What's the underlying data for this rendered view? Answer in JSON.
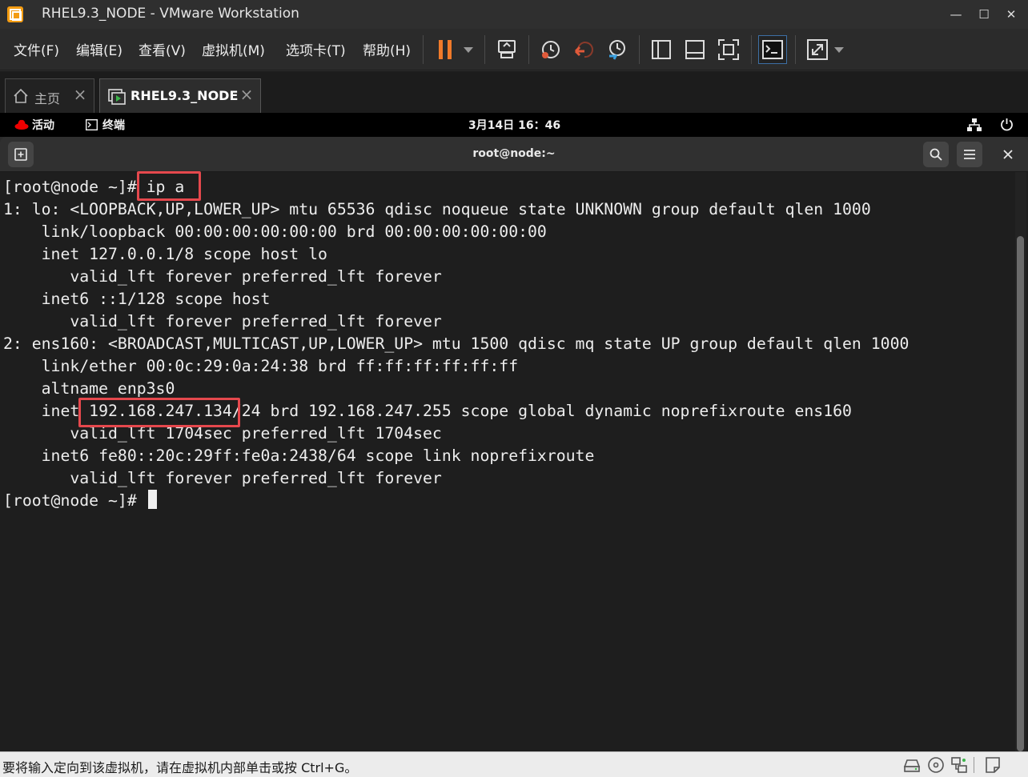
{
  "window": {
    "title": "RHEL9.3_NODE - VMware Workstation",
    "minimize": "—",
    "maximize": "☐",
    "close": "✕",
    "accent_color": "#f39c12"
  },
  "menu": {
    "items": [
      "文件(F)",
      "编辑(E)",
      "查看(V)",
      "虚拟机(M)",
      "选项卡(T)",
      "帮助(H)"
    ]
  },
  "toolbar": {
    "icons": [
      "pause-icon",
      "send-ctrl-alt-del-icon",
      "snapshot-take-icon",
      "snapshot-revert-icon",
      "snapshot-manager-icon",
      "library-view-icon",
      "thumbnail-view-icon",
      "fullscreen-icon",
      "console-view-icon",
      "stretch-view-icon"
    ]
  },
  "tabs": [
    {
      "label": "主页",
      "icon": "home-icon",
      "active": false
    },
    {
      "label": "RHEL9.3_NODE",
      "icon": "vm-icon",
      "active": true
    }
  ],
  "gnome": {
    "activities": "活动",
    "app": "终端",
    "clock": "3月14日  16：46",
    "status_icons": [
      "network-icon",
      "power-icon"
    ]
  },
  "terminal": {
    "title": "root@node:~",
    "lines": [
      "[root@node ~]# ip a",
      "1: lo: <LOOPBACK,UP,LOWER_UP> mtu 65536 qdisc noqueue state UNKNOWN group default qlen 1000",
      "    link/loopback 00:00:00:00:00:00 brd 00:00:00:00:00:00",
      "    inet 127.0.0.1/8 scope host lo",
      "       valid_lft forever preferred_lft forever",
      "    inet6 ::1/128 scope host",
      "       valid_lft forever preferred_lft forever",
      "2: ens160: <BROADCAST,MULTICAST,UP,LOWER_UP> mtu 1500 qdisc mq state UP group default qlen 1000",
      "    link/ether 00:0c:29:0a:24:38 brd ff:ff:ff:ff:ff:ff",
      "    altname enp3s0",
      "    inet 192.168.247.134/24 brd 192.168.247.255 scope global dynamic noprefixroute ens160",
      "       valid_lft 1704sec preferred_lft 1704sec",
      "    inet6 fe80::20c:29ff:fe0a:2438/64 scope link noprefixroute",
      "       valid_lft forever preferred_lft forever"
    ],
    "prompt": "[root@node ~]# ",
    "highlight_color": "#e5484d"
  },
  "statusbar": {
    "text": "要将输入定向到该虚拟机，请在虚拟机内部单击或按 Ctrl+G。",
    "icons": [
      "hard-disk-icon",
      "cd-rom-icon",
      "network-adapter-icon",
      "message-icon"
    ]
  }
}
